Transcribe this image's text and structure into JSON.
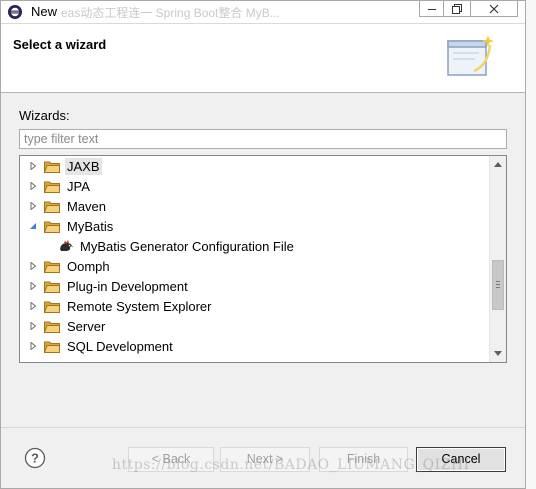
{
  "window": {
    "title": "New",
    "title_ghost": "eas动态工程连一  Spring Boot整合 MyB..."
  },
  "header": {
    "title": "Select a wizard"
  },
  "wizards": {
    "label": "Wizards:",
    "filter_placeholder": "type filter text",
    "filter_value": ""
  },
  "tree": {
    "items": [
      {
        "label": "JAXB",
        "expanded": false,
        "selected": true,
        "icon": "folder-icon"
      },
      {
        "label": "JPA",
        "expanded": false,
        "icon": "folder-icon"
      },
      {
        "label": "Maven",
        "expanded": false,
        "icon": "folder-icon"
      },
      {
        "label": "MyBatis",
        "expanded": true,
        "icon": "folder-icon"
      },
      {
        "label": "MyBatis Generator Configuration File",
        "child": true,
        "icon": "mybatis-bird-icon"
      },
      {
        "label": "Oomph",
        "expanded": false,
        "icon": "folder-icon"
      },
      {
        "label": "Plug-in Development",
        "expanded": false,
        "icon": "folder-icon"
      },
      {
        "label": "Remote System Explorer",
        "expanded": false,
        "icon": "folder-icon"
      },
      {
        "label": "Server",
        "expanded": false,
        "icon": "folder-icon"
      },
      {
        "label": "SQL Development",
        "expanded": false,
        "icon": "folder-icon"
      }
    ]
  },
  "buttons": {
    "back": "< Back",
    "next": "Next >",
    "finish": "Finish",
    "cancel": "Cancel"
  },
  "watermark": "https://blog.csdn.net/BADAO_LIUMANG_QIZHI",
  "colors": {
    "folder": "#e9b949",
    "selection": "#e5e5e5",
    "accent": "#3c7fd4"
  }
}
